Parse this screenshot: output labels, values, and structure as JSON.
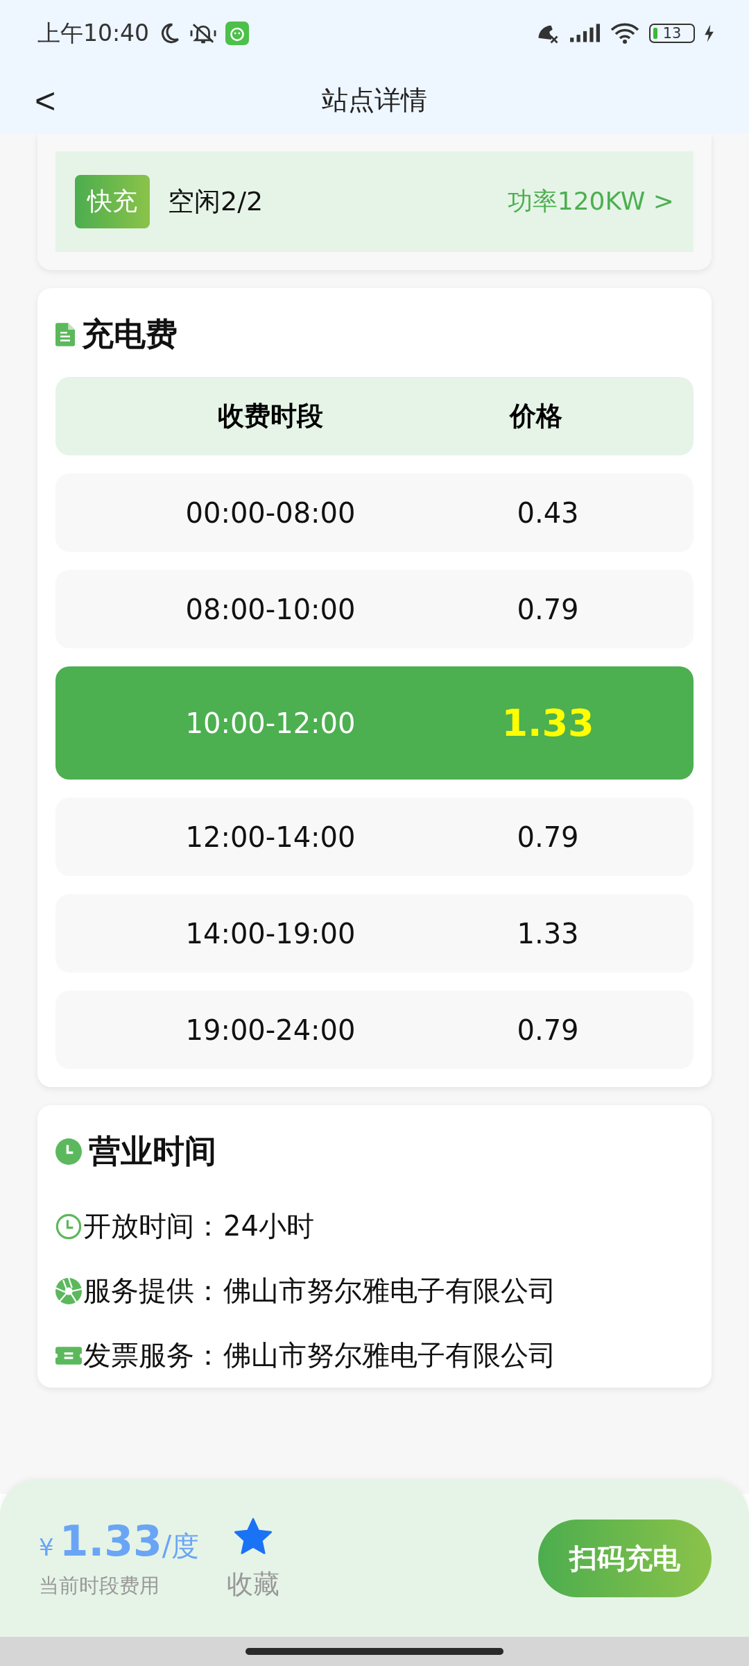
{
  "status_bar": {
    "time": "上午10:40",
    "battery": "13"
  },
  "header": {
    "back": "<",
    "title": "站点详情"
  },
  "charger": {
    "tag": "快充",
    "availability": "空闲2/2",
    "power": "功率120KW >"
  },
  "fees": {
    "title": "充电费",
    "columns": [
      "收费时段",
      "价格"
    ],
    "rows": [
      {
        "period": "00:00-08:00",
        "price": "0.43",
        "selected": false
      },
      {
        "period": "08:00-10:00",
        "price": "0.79",
        "selected": false
      },
      {
        "period": "10:00-12:00",
        "price": "1.33",
        "selected": true
      },
      {
        "period": "12:00-14:00",
        "price": "0.79",
        "selected": false
      },
      {
        "period": "14:00-19:00",
        "price": "1.33",
        "selected": false
      },
      {
        "period": "19:00-24:00",
        "price": "0.79",
        "selected": false
      }
    ]
  },
  "hours": {
    "title": "营业时间",
    "items": [
      {
        "kind": "clock",
        "label": "开放时间：",
        "value": "24小时"
      },
      {
        "kind": "aperture",
        "label": "服务提供：",
        "value": "佛山市努尔雅电子有限公司"
      },
      {
        "kind": "ticket",
        "label": "发票服务：",
        "value": "佛山市努尔雅电子有限公司"
      }
    ]
  },
  "footer": {
    "currency": "¥",
    "price": "1.33",
    "unit": "/度",
    "caption": "当前时段费用",
    "favorite": {
      "label": "收藏",
      "on": true
    },
    "button": "扫码充电"
  }
}
